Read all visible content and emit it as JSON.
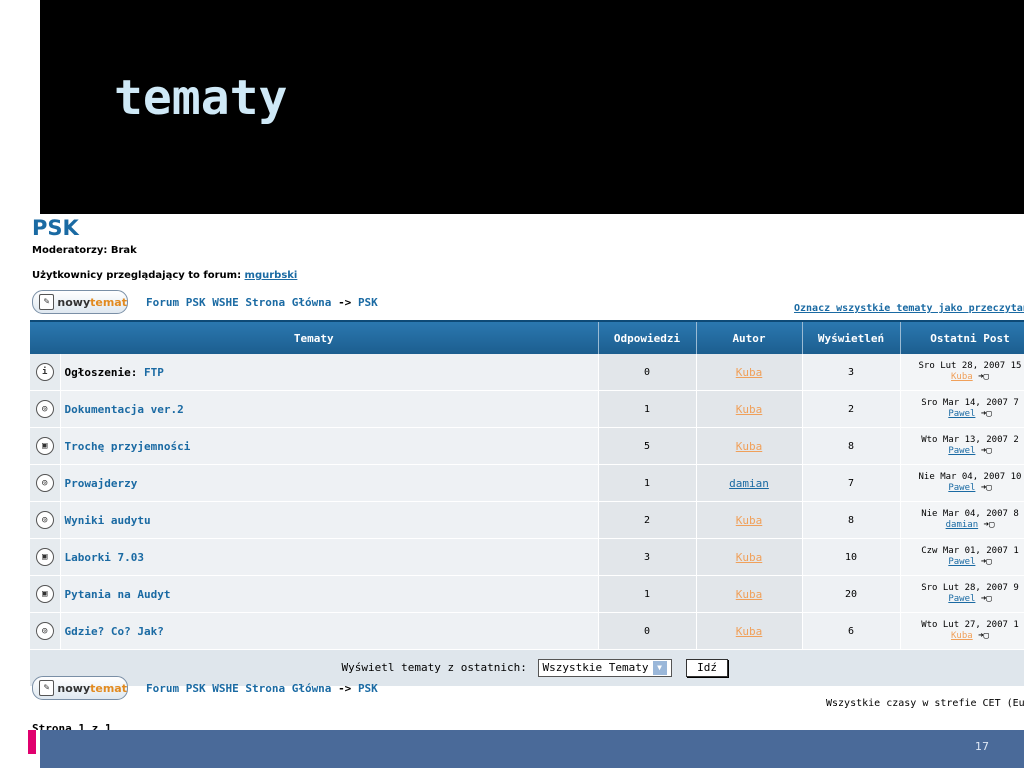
{
  "slide": {
    "title": "tematy",
    "number": "17"
  },
  "forum": {
    "name": "PSK",
    "moderators": "Moderatorzy: Brak",
    "viewers_label": "Użytkownicy przeglądający to forum:",
    "viewer_name": "mgurbski",
    "new_topic_part1": "nowy",
    "new_topic_part2": "temat",
    "nav_home": "Forum PSK WSHE Strona Główna",
    "nav_sep": "->",
    "nav_current": "PSK",
    "mark_all_read": "Oznacz wszystkie tematy jako przeczytane"
  },
  "table": {
    "headers": {
      "topics": "Tematy",
      "replies": "Odpowiedzi",
      "author": "Autor",
      "views": "Wyświetleń",
      "last_post": "Ostatni Post"
    },
    "rows": [
      {
        "prefix": "Ogłoszenie:",
        "title": "FTP",
        "replies": "0",
        "author": "Kuba",
        "views": "3",
        "last_date": "Sro Lut 28, 2007 15",
        "last_user": "Kuba",
        "icon": "announcement-icon",
        "icon_glyph": "i"
      },
      {
        "prefix": "",
        "title": "Dokumentacja ver.2",
        "replies": "1",
        "author": "Kuba",
        "views": "2",
        "last_date": "Sro Mar 14, 2007 7",
        "last_user": "Pawel",
        "icon": "topic-icon",
        "icon_glyph": "◎"
      },
      {
        "prefix": "",
        "title": "Trochę przyjemności",
        "replies": "5",
        "author": "Kuba",
        "views": "8",
        "last_date": "Wto Mar 13, 2007 2",
        "last_user": "Pawel",
        "icon": "locked-topic-icon",
        "icon_glyph": "▣"
      },
      {
        "prefix": "",
        "title": "Prowajderzy",
        "replies": "1",
        "author": "damian",
        "views": "7",
        "last_date": "Nie Mar 04, 2007 10",
        "last_user": "Pawel",
        "icon": "topic-icon",
        "icon_glyph": "◎"
      },
      {
        "prefix": "",
        "title": "Wyniki audytu",
        "replies": "2",
        "author": "Kuba",
        "views": "8",
        "last_date": "Nie Mar 04, 2007 8",
        "last_user": "damian",
        "icon": "topic-icon",
        "icon_glyph": "◎"
      },
      {
        "prefix": "",
        "title": "Laborki 7.03",
        "replies": "3",
        "author": "Kuba",
        "views": "10",
        "last_date": "Czw Mar 01, 2007 1",
        "last_user": "Pawel",
        "icon": "locked-topic-icon",
        "icon_glyph": "▣"
      },
      {
        "prefix": "",
        "title": "Pytania na Audyt",
        "replies": "1",
        "author": "Kuba",
        "views": "20",
        "last_date": "Sro Lut 28, 2007 9",
        "last_user": "Pawel",
        "icon": "locked-topic-icon",
        "icon_glyph": "▣"
      },
      {
        "prefix": "",
        "title": "Gdzie? Co? Jak?",
        "replies": "0",
        "author": "Kuba",
        "views": "6",
        "last_date": "Wto Lut 27, 2007 1",
        "last_user": "Kuba",
        "icon": "topic-icon",
        "icon_glyph": "◎"
      }
    ],
    "filter_label": "Wyświetl tematy z ostatnich:",
    "filter_value": "Wszystkie Tematy",
    "go_label": "Idź"
  },
  "footer": {
    "timezone": "Wszystkie czasy w strefie CET (Eu",
    "pages": "Strona 1 z 1"
  },
  "colors": {
    "header_blue": "#1c5e8f",
    "link_blue": "#1a6aa3",
    "author_orange": "#f0a05a",
    "footer_bar": "#4a6a99",
    "accent_pink": "#e0006e"
  }
}
